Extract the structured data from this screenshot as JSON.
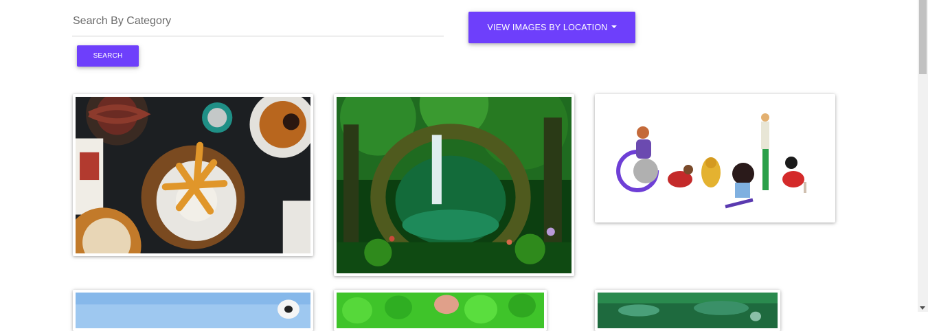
{
  "search": {
    "placeholder": "Search By Category",
    "button_label": "SEARCH"
  },
  "location_menu": {
    "label": "VIEW IMAGES BY LOCATION"
  },
  "colors": {
    "accent": "#6e3ffb"
  },
  "gallery": {
    "images": [
      {
        "subject": "food"
      },
      {
        "subject": "forest"
      },
      {
        "subject": "illustration"
      },
      {
        "subject": "sky"
      },
      {
        "subject": "foliage"
      },
      {
        "subject": "underwater"
      }
    ]
  }
}
